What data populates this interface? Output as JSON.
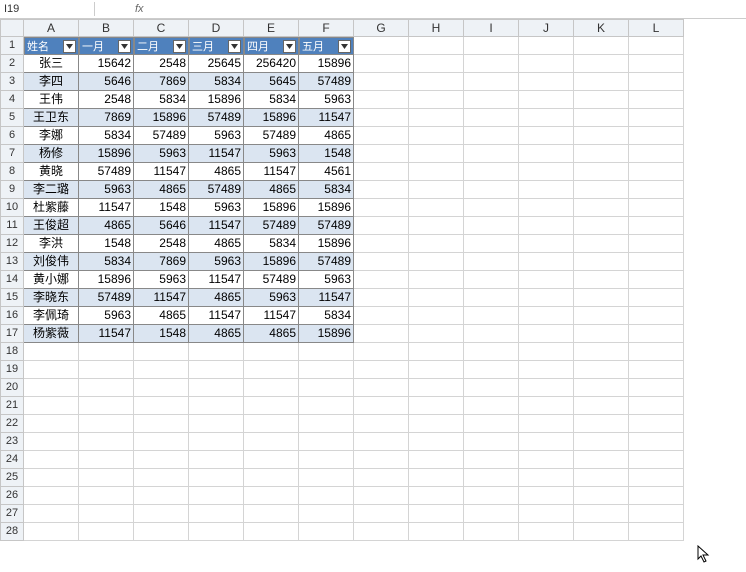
{
  "cell_reference": "I19",
  "fx_label": "fx",
  "col_widths": {
    "A": 55,
    "B": 55,
    "C": 55,
    "D": 55,
    "E": 55,
    "F": 55,
    "other": 55
  },
  "visible_columns": [
    "A",
    "B",
    "C",
    "D",
    "E",
    "F",
    "G",
    "H",
    "I",
    "J",
    "K",
    "L"
  ],
  "visible_rows": 28,
  "chart_data": {
    "type": "table",
    "headers": [
      "姓名",
      "一月",
      "二月",
      "三月",
      "四月",
      "五月"
    ],
    "rows": [
      [
        "张三",
        15642,
        2548,
        25645,
        256420,
        15896
      ],
      [
        "李四",
        5646,
        7869,
        5834,
        5645,
        57489
      ],
      [
        "王伟",
        2548,
        5834,
        15896,
        5834,
        5963
      ],
      [
        "王卫东",
        7869,
        15896,
        57489,
        15896,
        11547
      ],
      [
        "李娜",
        5834,
        57489,
        5963,
        57489,
        4865
      ],
      [
        "杨修",
        15896,
        5963,
        11547,
        5963,
        1548
      ],
      [
        "黄晓",
        57489,
        11547,
        4865,
        11547,
        4561
      ],
      [
        "李二璐",
        5963,
        4865,
        57489,
        4865,
        5834
      ],
      [
        "杜紫藤",
        11547,
        1548,
        5963,
        15896,
        15896
      ],
      [
        "王俊超",
        4865,
        5646,
        11547,
        57489,
        57489
      ],
      [
        "李洪",
        1548,
        2548,
        4865,
        5834,
        15896
      ],
      [
        "刘俊伟",
        5834,
        7869,
        5963,
        15896,
        57489
      ],
      [
        "黄小娜",
        15896,
        5963,
        11547,
        57489,
        5963
      ],
      [
        "李晓东",
        57489,
        11547,
        4865,
        5963,
        11547
      ],
      [
        "李佩琦",
        5963,
        4865,
        11547,
        11547,
        5834
      ],
      [
        "杨紫薇",
        11547,
        1548,
        4865,
        4865,
        15896
      ]
    ]
  }
}
